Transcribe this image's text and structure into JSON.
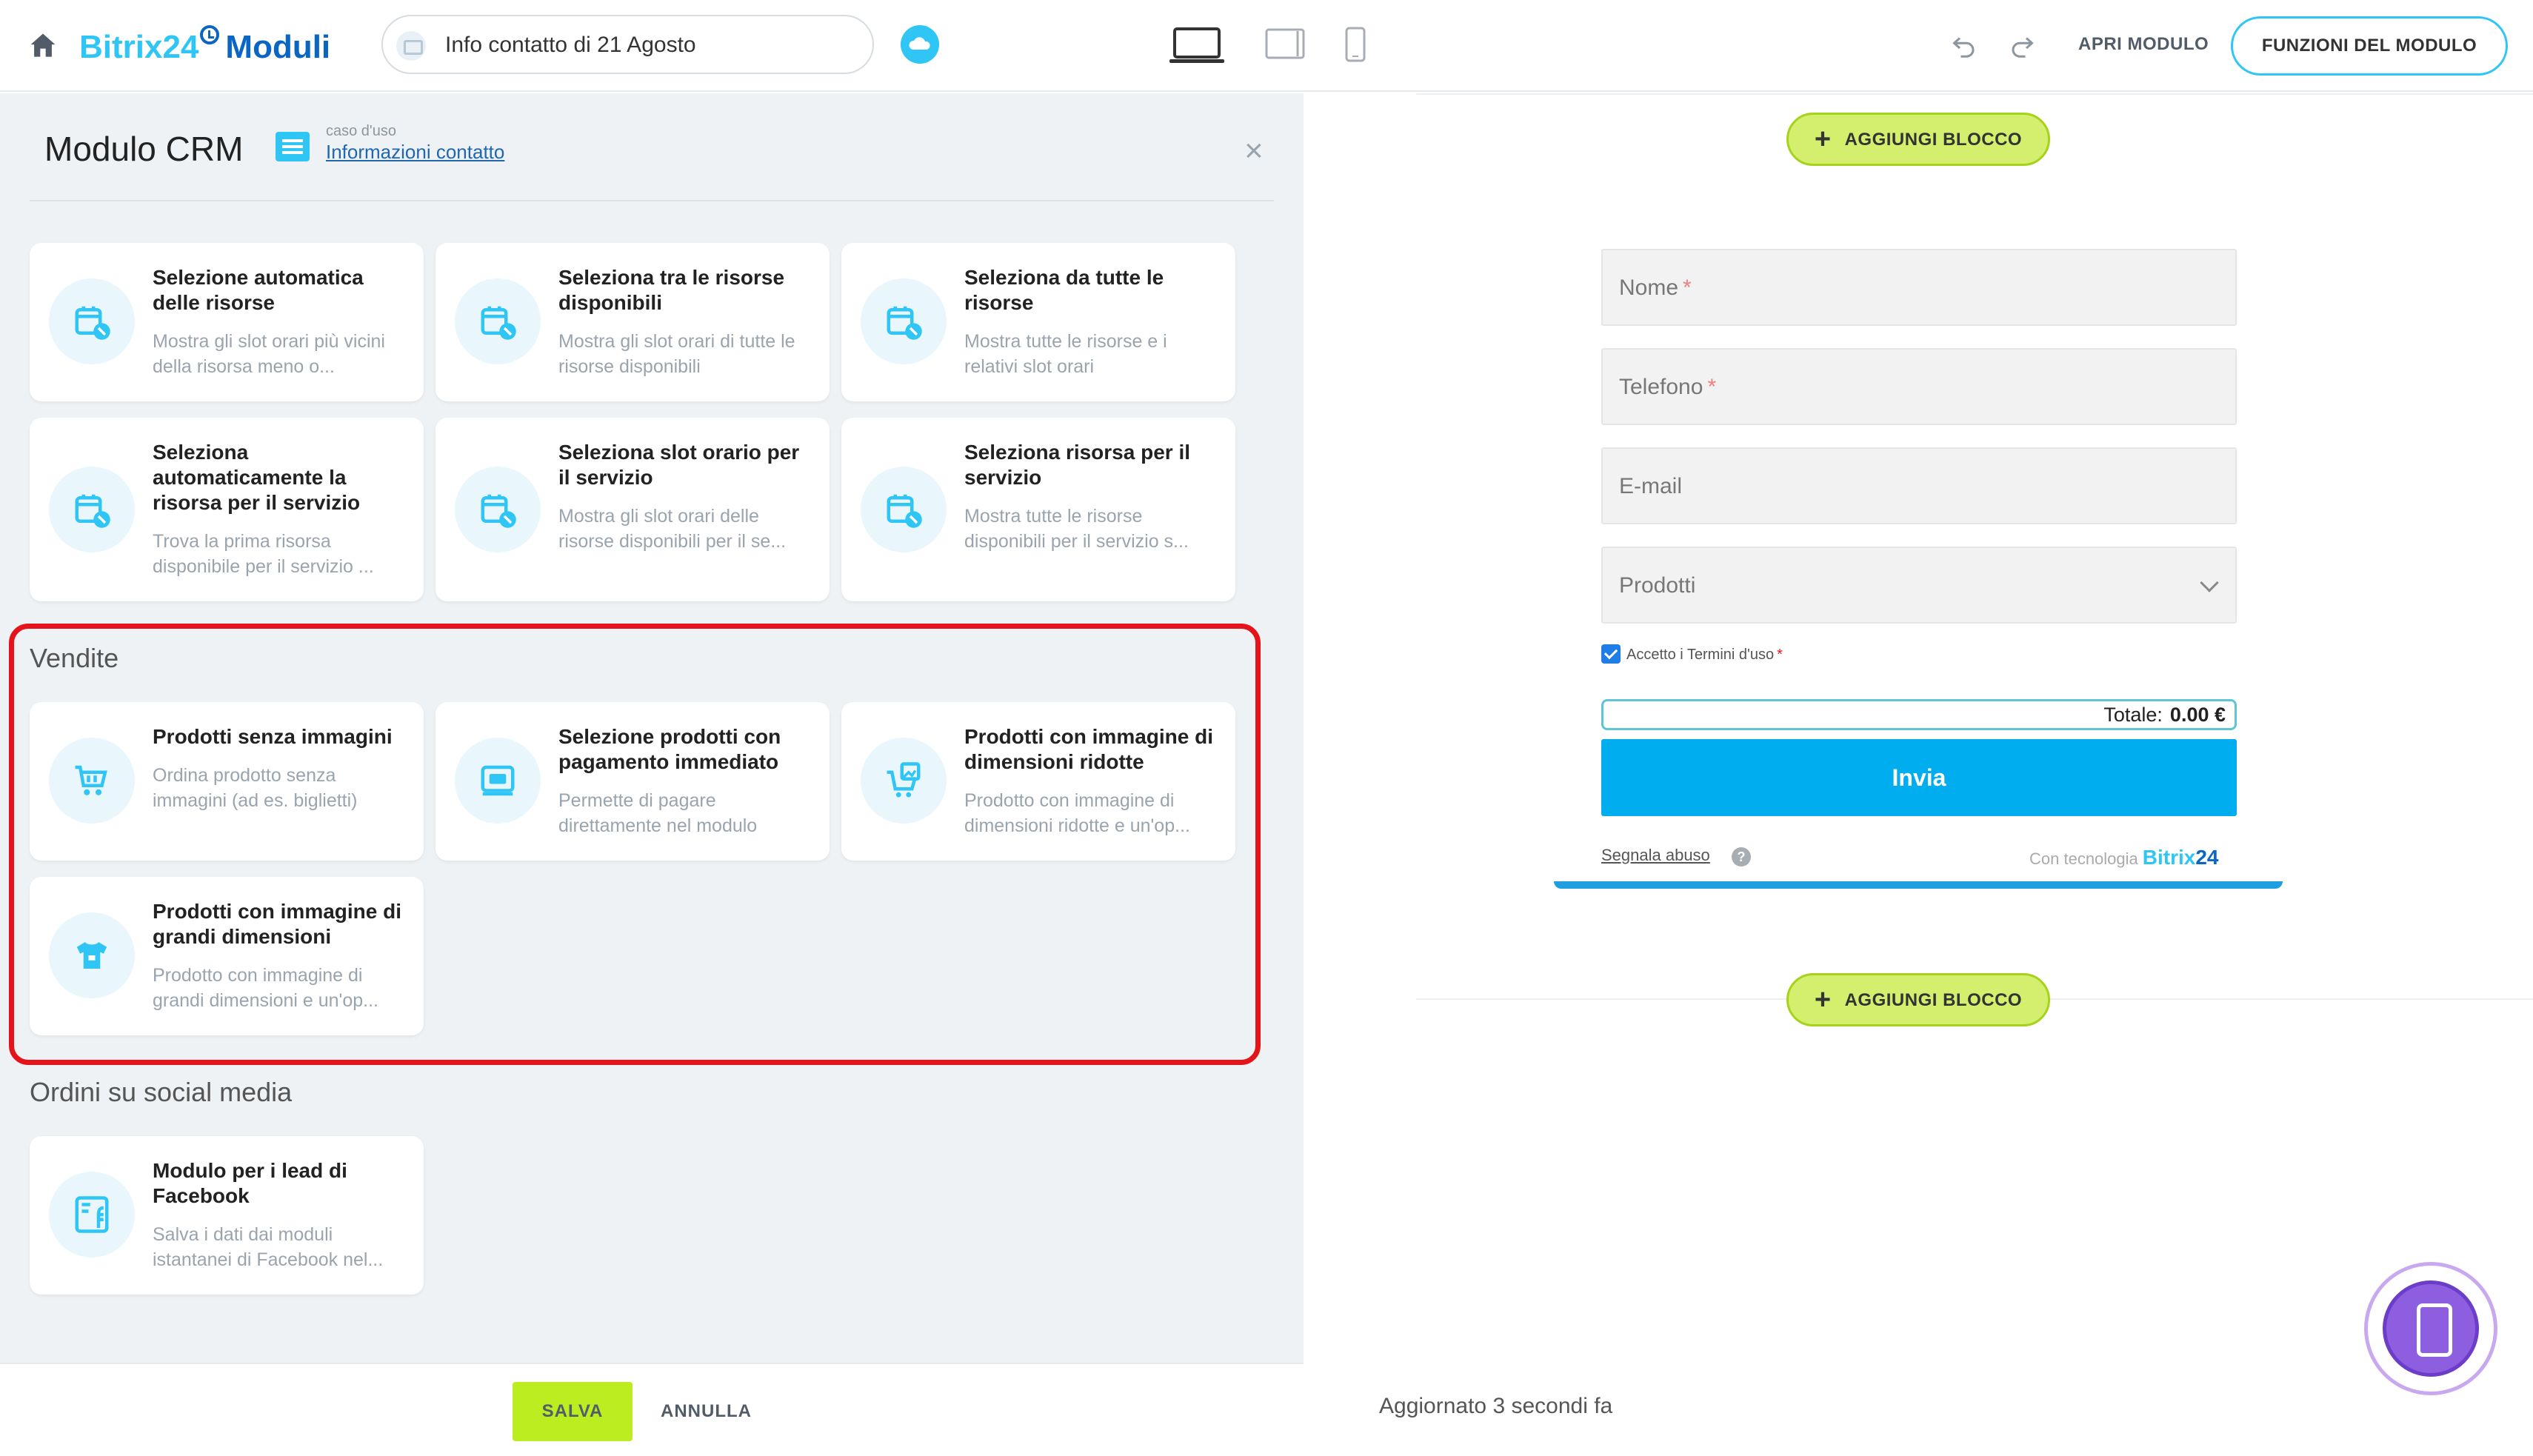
{
  "header": {
    "brand_name": "Bitrix24",
    "brand_product": "Moduli",
    "form_title": "Info contatto di 21 Agosto",
    "open_form": "APRI MODULO",
    "form_functions": "FUNZIONI DEL MODULO"
  },
  "panel": {
    "title": "Modulo CRM",
    "use_case_label": "caso d'uso",
    "use_case_link": "Informazioni contatto",
    "resource_cards": [
      {
        "title": "Selezione automatica delle risorse",
        "desc": "Mostra gli slot orari più vicini della risorsa meno o..."
      },
      {
        "title": "Seleziona tra le risorse disponibili",
        "desc": "Mostra gli slot orari di tutte le risorse disponibili"
      },
      {
        "title": "Seleziona da tutte le risorse",
        "desc": "Mostra tutte le risorse e i relativi slot orari"
      },
      {
        "title": "Seleziona automaticamente la risorsa per il servizio",
        "desc": "Trova la prima risorsa disponibile per il servizio ..."
      },
      {
        "title": "Seleziona slot orario per il servizio",
        "desc": "Mostra gli slot orari delle risorse disponibili per il se..."
      },
      {
        "title": "Seleziona risorsa per il servizio",
        "desc": "Mostra tutte le risorse disponibili per il servizio s..."
      }
    ],
    "sales_section": "Vendite",
    "sales_cards": [
      {
        "title": "Prodotti senza immagini",
        "desc": "Ordina prodotto senza immagini (ad es. biglietti)"
      },
      {
        "title": "Selezione prodotti con pagamento immediato",
        "desc": "Permette di pagare direttamente nel modulo"
      },
      {
        "title": "Prodotti con immagine di dimensioni ridotte",
        "desc": "Prodotto con immagine di dimensioni ridotte e un'op..."
      },
      {
        "title": "Prodotti con immagine di grandi dimensioni",
        "desc": "Prodotto con immagine di grandi dimensioni e un'op..."
      }
    ],
    "social_section": "Ordini su social media",
    "social_cards": [
      {
        "title": "Modulo per i lead di Facebook",
        "desc": "Salva i dati dai moduli istantanei di Facebook nel..."
      }
    ],
    "save": "SALVA",
    "cancel": "ANNULLA"
  },
  "preview": {
    "add_block": "AGGIUNGI BLOCCO",
    "field_name": "Nome",
    "field_phone": "Telefono",
    "field_email": "E-mail",
    "field_products": "Prodotti",
    "required_mark": "*",
    "consent": "Accetto i Termini d'uso",
    "total_label": "Totale:",
    "total_value": "0.00 €",
    "submit": "Invia",
    "report_abuse": "Segnala abuso",
    "powered_by": "Con tecnologia",
    "powered_brand": "Bitrix",
    "powered_num": "24",
    "updated": "Aggiornato 3 secondi fa"
  },
  "colors": {
    "accent": "#2fc6f6",
    "brand_dark": "#0b66c3",
    "save_green": "#bbed21",
    "highlight_red": "#e5141b",
    "submit_blue": "#00aeef"
  }
}
